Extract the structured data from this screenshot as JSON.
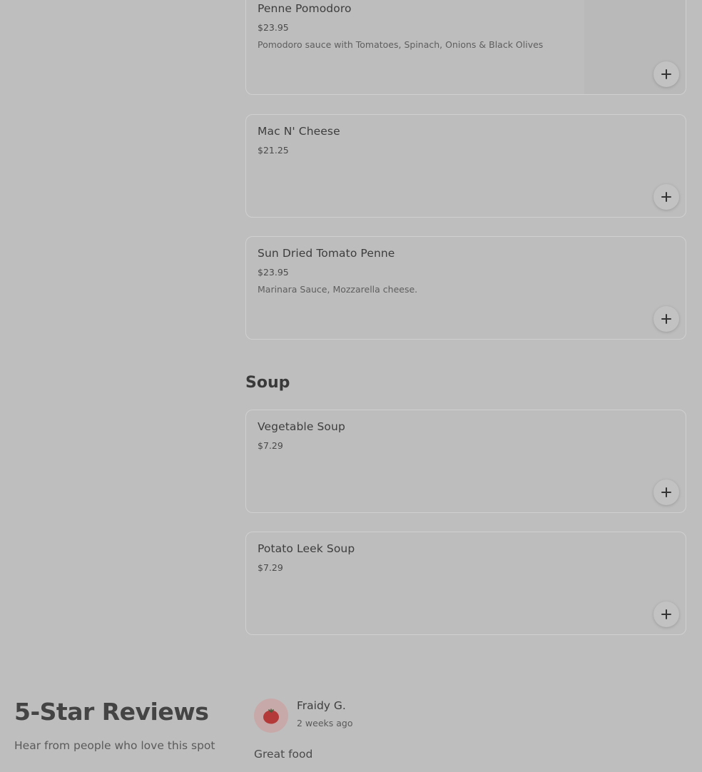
{
  "sections": {
    "pasta": {
      "items": [
        {
          "name": "Penne Pomodoro",
          "price": "$23.95",
          "description": "Pomodoro sauce with Tomatoes, Spinach, Onions & Black Olives"
        },
        {
          "name": "Mac N' Cheese",
          "price": "$21.25",
          "description": ""
        },
        {
          "name": "Sun Dried Tomato Penne",
          "price": "$23.95",
          "description": "Marinara Sauce, Mozzarella cheese."
        }
      ]
    },
    "soup": {
      "title": "Soup",
      "items": [
        {
          "name": "Vegetable Soup",
          "price": "$7.29",
          "description": ""
        },
        {
          "name": "Potato Leek Soup",
          "price": "$7.29",
          "description": ""
        }
      ]
    }
  },
  "reviews": {
    "title": "5-Star Reviews",
    "subtitle": "Hear from people who love this spot",
    "items": [
      {
        "reviewer": "Fraidy G.",
        "time": "2 weeks ago",
        "text": "Great food",
        "avatar_icon": "tomato-avatar-icon"
      }
    ]
  },
  "icons": {
    "add": "plus-icon"
  },
  "colors": {
    "overlay_bg": "#bebebe",
    "avatar_bg": "#c8a9a9",
    "avatar_icon": "#b43a3a"
  }
}
